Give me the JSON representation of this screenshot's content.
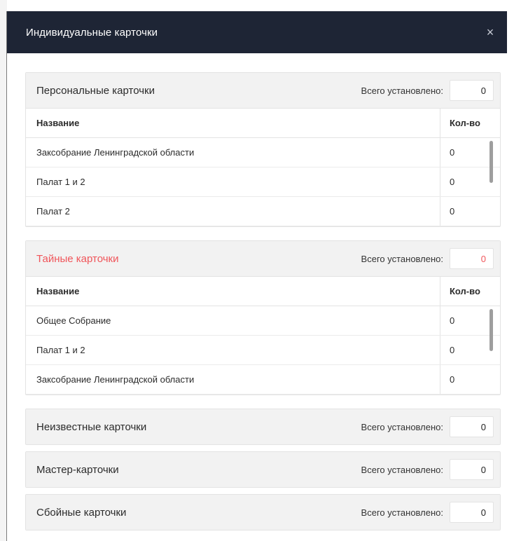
{
  "modal": {
    "title": "Индивидуальные карточки",
    "close_label": "×"
  },
  "total_label": "Всего установлено:",
  "columns": {
    "name": "Название",
    "qty": "Кол-во"
  },
  "personal": {
    "title": "Персональные карточки",
    "total": "0",
    "rows": [
      {
        "name": "Заксобрание Ленинградской области",
        "qty": "0"
      },
      {
        "name": "Палат 1 и 2",
        "qty": "0"
      },
      {
        "name": "Палат 2",
        "qty": "0"
      }
    ]
  },
  "secret": {
    "title": "Тайные карточки",
    "total": "0",
    "rows": [
      {
        "name": "Общее Собрание",
        "qty": "0"
      },
      {
        "name": "Палат 1 и 2",
        "qty": "0"
      },
      {
        "name": "Заксобрание Ленинградской области",
        "qty": "0"
      }
    ]
  },
  "unknown": {
    "title": "Неизвестные карточки",
    "total": "0"
  },
  "master": {
    "title": "Мастер-карточки",
    "total": "0"
  },
  "faulty": {
    "title": "Сбойные карточки",
    "total": "0"
  },
  "colors": {
    "header_bg": "#1e2535",
    "danger": "#f0555a",
    "panel_header_bg": "#f2f2f2"
  }
}
